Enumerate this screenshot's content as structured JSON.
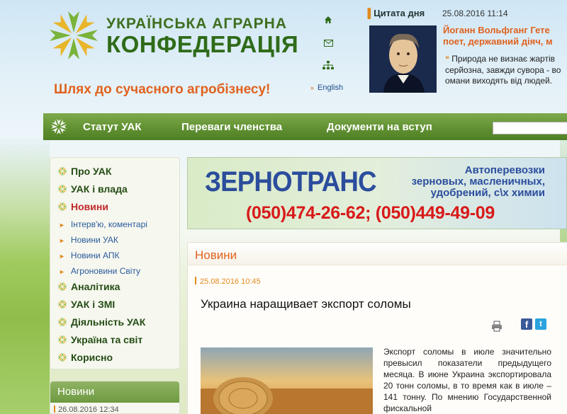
{
  "header": {
    "brand_top": "УКРАЇНСЬКА АГРАРНА",
    "brand_bottom": "КОНФЕДЕРАЦІЯ",
    "slogan": "Шлях до сучасного агробізнесу!",
    "tools": [
      {
        "icon": "home-icon"
      },
      {
        "icon": "mail-icon"
      },
      {
        "icon": "sitemap-icon"
      }
    ],
    "english_label": "English",
    "quote": {
      "heading": "Цитата дня",
      "date": "25.08.2016 11:14",
      "name_line1": "Йоганн Вольфганг Гете",
      "name_line2": "поет, державний діяч, м",
      "text_line1": "Природа не визнає жартів",
      "text_line2": "серйозна, завжди сувора - во",
      "text_line3": "омани виходять від людей."
    }
  },
  "nav": {
    "items": [
      "Статут УАК",
      "Переваги членства",
      "Документи на вступ"
    ],
    "search_value": ""
  },
  "sidebar": {
    "menu": [
      {
        "label": "Про УАК",
        "type": "main"
      },
      {
        "label": "УАК і влада",
        "type": "main"
      },
      {
        "label": "Новини",
        "type": "active"
      },
      {
        "label": "Інтерв'ю, коментарі",
        "type": "sub"
      },
      {
        "label": "Новини УАК",
        "type": "sub"
      },
      {
        "label": "Новини АПК",
        "type": "sub"
      },
      {
        "label": "Агроновини Світу",
        "type": "sub"
      },
      {
        "label": "Аналітика",
        "type": "main"
      },
      {
        "label": "УАК і ЗМІ",
        "type": "main"
      },
      {
        "label": "Діяльність УАК",
        "type": "main"
      },
      {
        "label": "Україна та світ",
        "type": "main"
      },
      {
        "label": "Корисно",
        "type": "main"
      }
    ],
    "news_block": {
      "title": "Новини",
      "date": "26.08.2016 12:34"
    }
  },
  "banner": {
    "title": "ЗЕРНОТРАНС",
    "sub_line1": "Автоперевозки",
    "sub_line2": "зерновых, масленичных,",
    "sub_line3": "удобрений, с\\х химии",
    "phones": "(050)474-26-62; (050)449-49-09"
  },
  "article": {
    "section_title": "Новини",
    "date": "25.08.2016 10:45",
    "title": "Украина наращивает экспорт соломы",
    "body": "Экспорт соломы в июле значительно превысил показатели предыдущего месяца. В июне Украина экспортировала 20 тонн соломы, в то время как в июле – 141 тонну. По мнению Государственной фискальной"
  },
  "colors": {
    "brand_green": "#2f6b19",
    "accent_orange": "#e0621e",
    "nav_green": "#5f8f30",
    "banner_blue": "#2b4d9c",
    "banner_red": "#d81a1a"
  }
}
